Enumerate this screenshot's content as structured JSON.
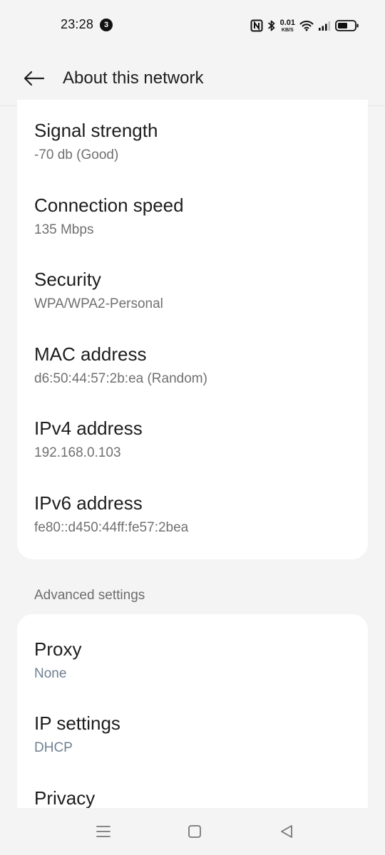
{
  "status_bar": {
    "time": "23:28",
    "notification_count": "3",
    "net_speed_value": "0.01",
    "net_speed_unit": "KB/S",
    "icons": [
      "nfc-icon",
      "bluetooth-icon",
      "wifi-icon",
      "signal-icon",
      "battery-icon"
    ]
  },
  "header": {
    "back_icon": "arrow-left-icon",
    "title": "About this network"
  },
  "network_info": {
    "items": [
      {
        "title": "Signal strength",
        "value": "-70 db (Good)"
      },
      {
        "title": "Connection speed",
        "value": "135 Mbps"
      },
      {
        "title": "Security",
        "value": "WPA/WPA2-Personal"
      },
      {
        "title": "MAC address",
        "value": "d6:50:44:57:2b:ea (Random)"
      },
      {
        "title": "IPv4 address",
        "value": "192.168.0.103"
      },
      {
        "title": "IPv6 address",
        "value": "fe80::d450:44ff:fe57:2bea"
      }
    ]
  },
  "advanced": {
    "header": "Advanced settings",
    "items": [
      {
        "title": "Proxy",
        "value": "None"
      },
      {
        "title": "IP settings",
        "value": "DHCP"
      },
      {
        "title": "Privacy"
      }
    ]
  },
  "nav_bar": {
    "icons": [
      "menu-icon",
      "home-icon",
      "back-icon"
    ]
  },
  "colors": {
    "background": "#f4f4f4",
    "card": "#ffffff",
    "primary_text": "#1d1d1d",
    "secondary_text": "#707070",
    "accent_value_text": "#6f8090"
  }
}
